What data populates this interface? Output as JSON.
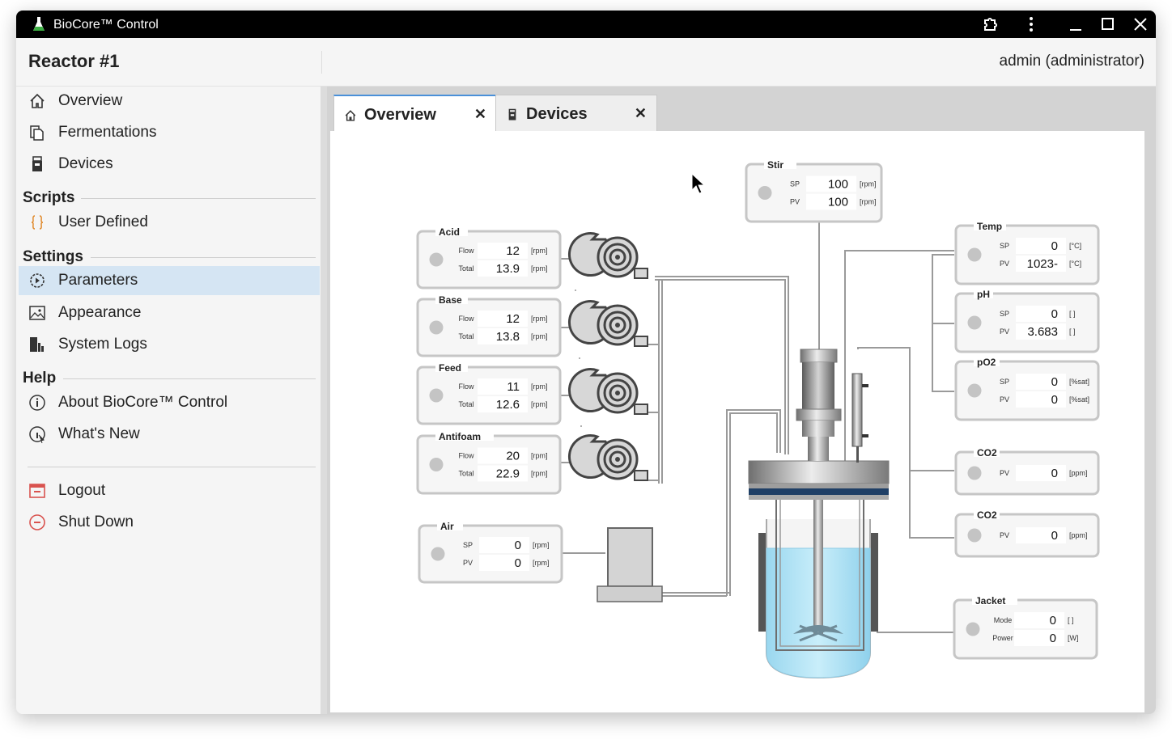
{
  "app": {
    "title": "BioCore™ Control"
  },
  "header": {
    "reactor": "Reactor #1",
    "user": "admin (administrator)"
  },
  "sidebar": {
    "items": [
      {
        "label": "Overview",
        "icon": "home-icon"
      },
      {
        "label": "Fermentations",
        "icon": "documents-icon"
      },
      {
        "label": "Devices",
        "icon": "device-icon"
      }
    ],
    "scripts_title": "Scripts",
    "scripts": [
      {
        "label": "User Defined",
        "icon": "braces-icon"
      }
    ],
    "settings_title": "Settings",
    "settings": [
      {
        "label": "Parameters",
        "icon": "gear-icon",
        "active": true
      },
      {
        "label": "Appearance",
        "icon": "image-icon"
      },
      {
        "label": "System Logs",
        "icon": "logs-icon"
      }
    ],
    "help_title": "Help",
    "help": [
      {
        "label": "About BioCore™ Control",
        "icon": "info-icon"
      },
      {
        "label": "What's New",
        "icon": "whats-new-icon"
      }
    ],
    "footer": [
      {
        "label": "Logout",
        "icon": "logout-icon"
      },
      {
        "label": "Shut Down",
        "icon": "shutdown-icon"
      }
    ]
  },
  "tabs": [
    {
      "label": "Overview",
      "icon": "home-icon",
      "close": "✕"
    },
    {
      "label": "Devices",
      "icon": "device-icon",
      "close": "✕"
    }
  ],
  "panels": {
    "stir": {
      "title": "Stir",
      "rows": [
        {
          "label": "SP",
          "value": "100",
          "unit": "[rpm]"
        },
        {
          "label": "PV",
          "value": "100",
          "unit": "[rpm]"
        }
      ]
    },
    "acid": {
      "title": "Acid",
      "rows": [
        {
          "label": "Flow",
          "value": "12",
          "unit": "[rpm]"
        },
        {
          "label": "Total",
          "value": "13.9",
          "unit": "[rpm]"
        }
      ]
    },
    "base": {
      "title": "Base",
      "rows": [
        {
          "label": "Flow",
          "value": "12",
          "unit": "[rpm]"
        },
        {
          "label": "Total",
          "value": "13.8",
          "unit": "[rpm]"
        }
      ]
    },
    "feed": {
      "title": "Feed",
      "rows": [
        {
          "label": "Flow",
          "value": "11",
          "unit": "[rpm]"
        },
        {
          "label": "Total",
          "value": "12.6",
          "unit": "[rpm]"
        }
      ]
    },
    "antifoam": {
      "title": "Antifoam",
      "rows": [
        {
          "label": "Flow",
          "value": "20",
          "unit": "[rpm]"
        },
        {
          "label": "Total",
          "value": "22.9",
          "unit": "[rpm]"
        }
      ]
    },
    "air": {
      "title": "Air",
      "rows": [
        {
          "label": "SP",
          "value": "0",
          "unit": "[rpm]"
        },
        {
          "label": "PV",
          "value": "0",
          "unit": "[rpm]"
        }
      ]
    },
    "temp": {
      "title": "Temp",
      "rows": [
        {
          "label": "SP",
          "value": "0",
          "unit": "[°C]"
        },
        {
          "label": "PV",
          "value": "1023-",
          "unit": "[°C]"
        }
      ]
    },
    "ph": {
      "title": "pH",
      "rows": [
        {
          "label": "SP",
          "value": "0",
          "unit": "[ ]"
        },
        {
          "label": "PV",
          "value": "3.683",
          "unit": "[ ]"
        }
      ]
    },
    "po2": {
      "title": "pO2",
      "rows": [
        {
          "label": "SP",
          "value": "0",
          "unit": "[%sat]"
        },
        {
          "label": "PV",
          "value": "0",
          "unit": "[%sat]"
        }
      ]
    },
    "co2a": {
      "title": "CO2",
      "rows": [
        {
          "label": "PV",
          "value": "0",
          "unit": "[ppm]"
        }
      ]
    },
    "co2b": {
      "title": "CO2",
      "rows": [
        {
          "label": "PV",
          "value": "0",
          "unit": "[ppm]"
        }
      ]
    },
    "jacket": {
      "title": "Jacket",
      "rows": [
        {
          "label": "Mode",
          "value": "0",
          "unit": "[ ]"
        },
        {
          "label": "Power",
          "value": "0",
          "unit": "[W]"
        }
      ]
    }
  },
  "colors": {
    "accent": "#d5e5f3",
    "liquid": "#a8e0f4",
    "danger": "#d9534f",
    "script": "#e08a2c"
  }
}
